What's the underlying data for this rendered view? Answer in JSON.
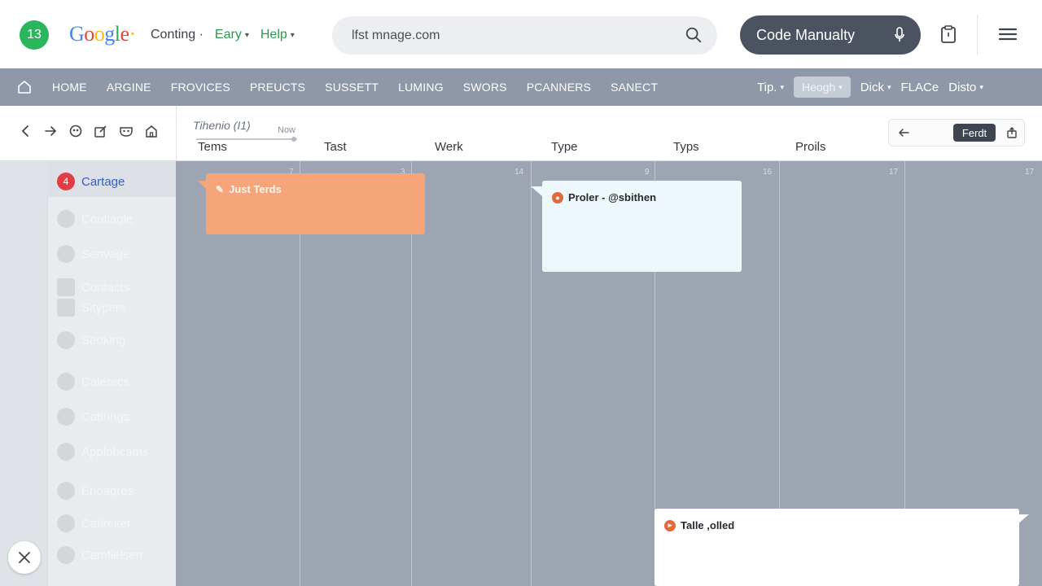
{
  "app": {
    "badge": "13",
    "logo_letters": [
      {
        "ch": "G",
        "color": "#4285f4"
      },
      {
        "ch": "o",
        "color": "#ea4335"
      },
      {
        "ch": "o",
        "color": "#fbbc05"
      },
      {
        "ch": "g",
        "color": "#4285f4"
      },
      {
        "ch": "l",
        "color": "#34a853"
      },
      {
        "ch": "e",
        "color": "#ea4335"
      },
      {
        "ch": "·",
        "color": "#fbbc05"
      }
    ]
  },
  "topnav": [
    {
      "label": "Conting ·",
      "color": "#3c4047"
    },
    {
      "label": "Eary",
      "color": "#2a9b4a"
    },
    {
      "label": "Help",
      "color": "#2a9b4a"
    }
  ],
  "address": {
    "value": "lfst mnage.com",
    "search_icon": "search-icon"
  },
  "code_button": {
    "label": "Code Manualty",
    "icon": "microphone-icon"
  },
  "navbar": {
    "links": [
      "HOME",
      "ARGINE",
      "FROVICES",
      "PREUCTS",
      "SUSSETT",
      "LUMING",
      "SWORS",
      "PCANNERS",
      "SANECT"
    ],
    "right": [
      {
        "label": "Tip.",
        "chevron": true,
        "pill": false
      },
      {
        "label": "Heogh",
        "chevron": true,
        "pill": true
      },
      {
        "label": "Dick",
        "chevron": true,
        "pill": false
      },
      {
        "label": "FLACe",
        "chevron": false,
        "pill": false
      },
      {
        "label": "Disto",
        "chevron": true,
        "pill": false
      }
    ]
  },
  "toolbar": {
    "timeline_label": "Tihenio (I1)",
    "now_label": "Now",
    "columns": [
      "Tems",
      "Tast",
      "Werk",
      "Type",
      "Typs",
      "Proils"
    ],
    "field_label": "Ferdt"
  },
  "sidebar": {
    "items": [
      {
        "label": "Cartage",
        "badge": "4",
        "active": true
      },
      {
        "label": "Coutiagle",
        "badge": "",
        "active": false
      },
      {
        "label": "Senvage",
        "badge": "",
        "active": false
      },
      {
        "label": "Contacts",
        "badge": "",
        "active": false
      },
      {
        "label": "Sitypers",
        "badge": "",
        "active": false
      },
      {
        "label": "Seoking",
        "badge": "",
        "active": false
      },
      {
        "label": "Calerecs",
        "badge": "",
        "active": false
      },
      {
        "label": "Catinngs",
        "badge": "",
        "active": false
      },
      {
        "label": "Applobcams",
        "badge": "",
        "active": false
      },
      {
        "label": "Enoagres",
        "badge": "",
        "active": false
      },
      {
        "label": "Catireiter",
        "badge": "",
        "active": false
      },
      {
        "label": "Camfielsen",
        "badge": "",
        "active": false
      }
    ]
  },
  "grid": {
    "day_numbers": [
      "7",
      "3",
      "14",
      "9",
      "16",
      "17",
      "17"
    ]
  },
  "cards": {
    "orange": {
      "title": "Just Terds",
      "color": "#f6a47a"
    },
    "blue": {
      "title": "Proler - @sbithen"
    },
    "white": {
      "title": "Talle ,olled"
    }
  }
}
